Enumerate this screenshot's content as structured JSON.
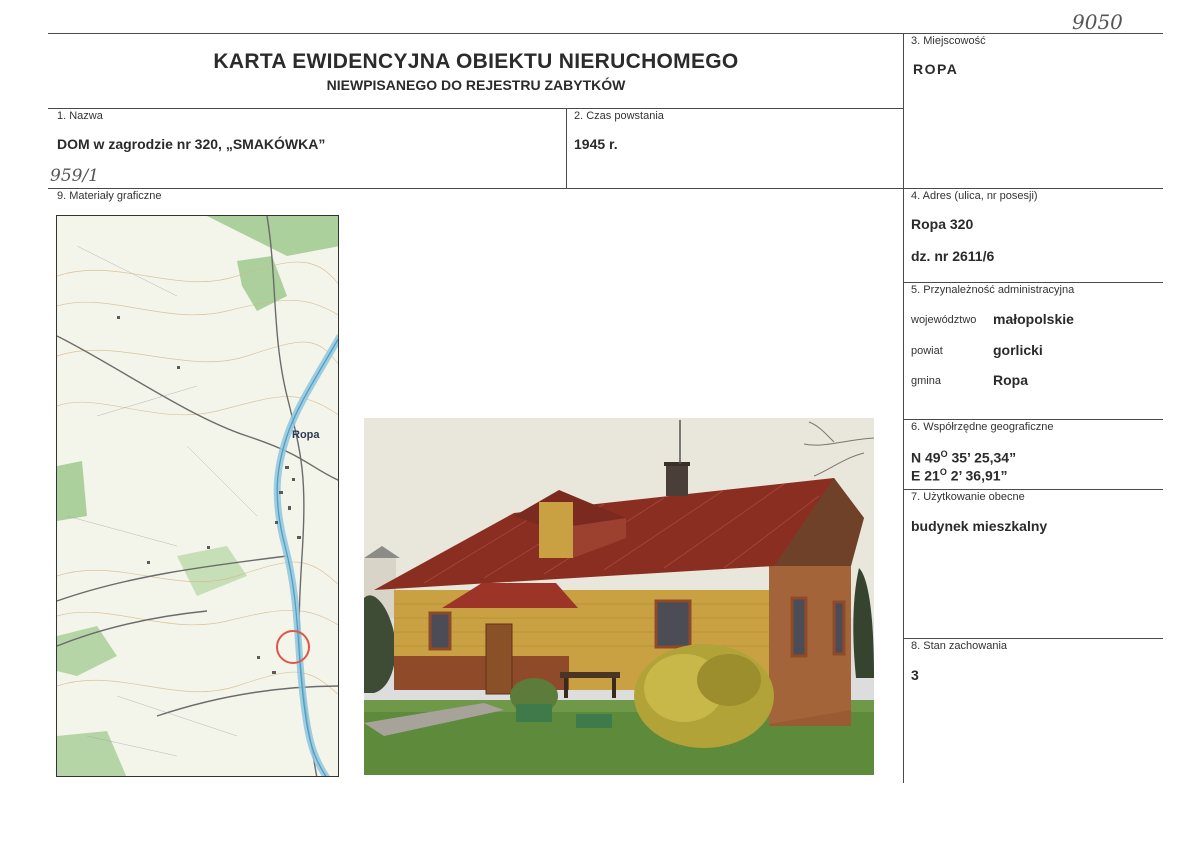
{
  "header": {
    "handwritten_number": "9050",
    "title": "KARTA EWIDENCYJNA OBIEKTU NIERUCHOMEGO",
    "subtitle": "NIEWPISANEGO DO REJESTRU ZABYTKÓW"
  },
  "fields": {
    "miejscowosc": {
      "label": "3. Miejscowość",
      "value": "ROPA"
    },
    "nazwa": {
      "label": "1. Nazwa",
      "value": "DOM w zagrodzie nr 320, „SMAKÓWKA”"
    },
    "czas": {
      "label": "2. Czas powstania",
      "value": "1945 r."
    },
    "handwritten_ref": "959/1",
    "materialy": {
      "label": "9. Materiały graficzne"
    },
    "adres": {
      "label": "4. Adres (ulica, nr posesji)",
      "line1": "Ropa 320",
      "line2": "dz. nr 2611/6"
    },
    "przynaleznosc": {
      "label": "5. Przynależność administracyjna",
      "woj_label": "województwo",
      "woj_value": "małopolskie",
      "powiat_label": "powiat",
      "powiat_value": "gorlicki",
      "gmina_label": "gmina",
      "gmina_value": "Ropa"
    },
    "wspolrzedne": {
      "label": "6. Współrzędne geograficzne",
      "n_prefix": "N 49",
      "n_deg": "O",
      "n_rest": " 35’ 25,34”",
      "e_prefix": "E 21",
      "e_deg": "O",
      "e_rest": " 2’ 36,91”"
    },
    "uzytkowanie": {
      "label": "7. Użytkowanie obecne",
      "value": "budynek mieszkalny"
    },
    "stan": {
      "label": "8. Stan zachowania",
      "value": "3"
    }
  },
  "map": {
    "place_label": "Ropa"
  },
  "colors": {
    "roof": "#8a2e22",
    "walls": "#c9a143",
    "lines": "#4a4a4a"
  }
}
